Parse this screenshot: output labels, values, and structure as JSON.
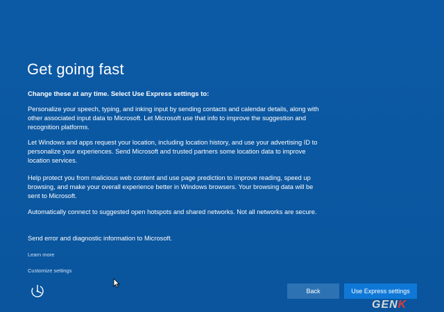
{
  "page": {
    "title": "Get going fast",
    "subtitle": "Change these at any time. Select Use Express settings to:",
    "paragraphs": [
      "Personalize your speech, typing, and inking input by sending contacts and calendar details, along with other associated input data to Microsoft. Let Microsoft use that info to improve the suggestion and recognition platforms.",
      "Let Windows and apps request your location, including location history, and use your advertising ID to personalize your experiences. Send Microsoft and trusted partners some location data to improve location services.",
      "Help protect you from malicious web content and use page prediction to improve reading, speed up browsing, and make your overall experience better in Windows browsers. Your browsing data will be sent to Microsoft.",
      "Automatically connect to suggested open hotspots and shared networks. Not all networks are secure.",
      "Send error and diagnostic information to Microsoft."
    ],
    "links": {
      "learn_more": "Learn more",
      "customize": "Customize settings"
    }
  },
  "buttons": {
    "back": "Back",
    "express": "Use Express settings"
  },
  "icons": {
    "ease_of_access": "ease-of-access-icon",
    "cursor": "mouse-pointer-icon"
  },
  "watermark": {
    "main": "GEN",
    "accent": "K"
  },
  "colors": {
    "background": "#0b57a0",
    "back_button": "#2d73b4",
    "express_button": "#0f78d7",
    "link": "#cfe2f5"
  }
}
